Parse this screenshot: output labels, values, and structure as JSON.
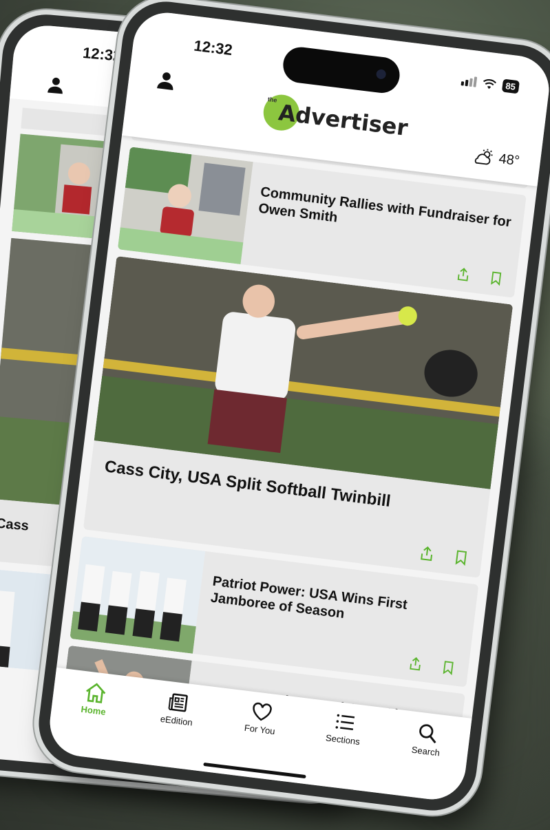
{
  "status": {
    "time": "12:32",
    "battery": "85"
  },
  "header": {
    "logo_the": "the",
    "logo_text": "Advertiser",
    "weather_temp": "48°"
  },
  "back_phone": {
    "time": "12:32",
    "partial_title": "Cass"
  },
  "articles": [
    {
      "title": "Community Rallies with Fundraiser for Owen Smith"
    },
    {
      "title": "Cass City, USA Split Softball Twinbill"
    },
    {
      "title": "Patriot Power: USA Wins First Jamboree of Season"
    },
    {
      "title": "Hartman, Anthes Lead Cass City Sweep of USA"
    }
  ],
  "nav": {
    "items": [
      {
        "label": "Home",
        "icon": "home-icon"
      },
      {
        "label": "eEdition",
        "icon": "newspaper-icon"
      },
      {
        "label": "For You",
        "icon": "heart-icon"
      },
      {
        "label": "Sections",
        "icon": "list-icon"
      },
      {
        "label": "Search",
        "icon": "search-icon"
      }
    ]
  },
  "colors": {
    "accent": "#5ab42d",
    "logo_green": "#8cc63f"
  }
}
